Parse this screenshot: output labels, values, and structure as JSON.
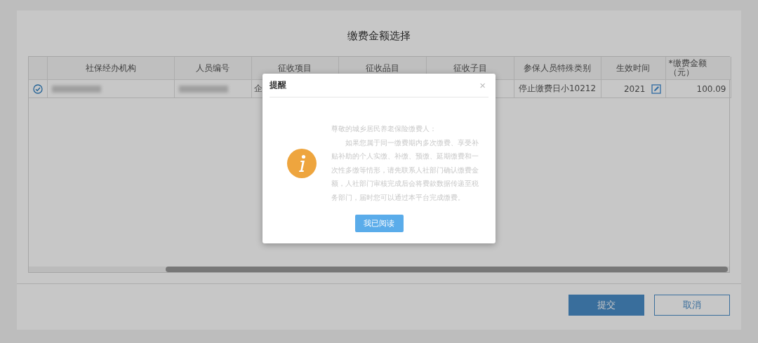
{
  "dialog_title": "缴费金额选择",
  "table": {
    "columns": [
      "社保经办机构",
      "人员编号",
      "征收项目",
      "征收品目",
      "征收子目",
      "参保人员特殊类别",
      "生效时间",
      "*缴费金额（元）"
    ],
    "rows": [
      {
        "selected": true,
        "cells": [
          {
            "kind": "redacted"
          },
          {
            "kind": "redacted"
          },
          {
            "kind": "text",
            "text": "企"
          },
          {
            "kind": "hidden"
          },
          {
            "kind": "hidden"
          },
          {
            "kind": "text",
            "text": "停止缴费日小10212"
          },
          {
            "kind": "editable",
            "text": "2021"
          },
          {
            "kind": "number",
            "text": "100.09"
          }
        ]
      }
    ]
  },
  "buttons": [
    {
      "label": "提交",
      "kind": "primary"
    },
    {
      "label": "取消",
      "kind": "secondary"
    }
  ],
  "modal": {
    "title": "提醒",
    "close": "×",
    "greeting": "尊敬的城乡居民养老保险缴费人：",
    "body": "如果您属于同一缴费期内多次缴费、享受补贴补助的个人实缴、补缴、预缴、延期缴费和一次性多缴等情形，请先联系人社部门确认缴费金额，人社部门审核完成后会将费款数据传递至税务部门，届时您可以通过本平台完成缴费。",
    "button": "我已阅读"
  }
}
